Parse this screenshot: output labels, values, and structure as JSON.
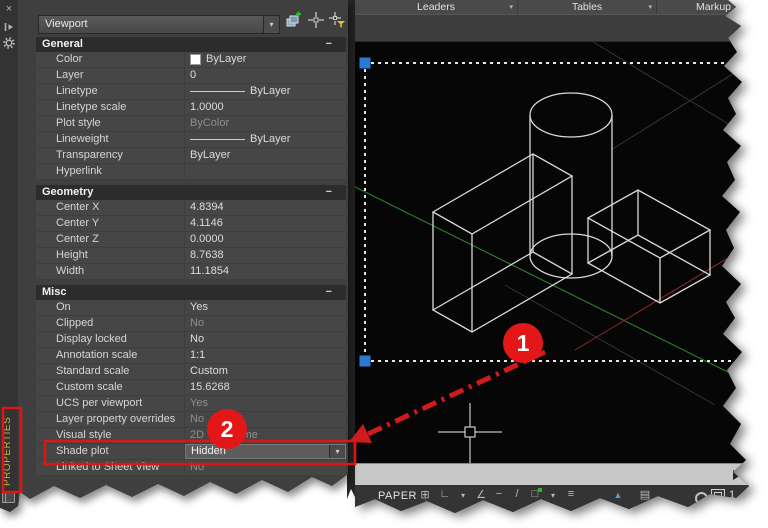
{
  "icons": {
    "dropdown_arrow": "▾",
    "collapse_minus": "−",
    "close": "×"
  },
  "ribbon": {
    "panels": [
      {
        "label": "Leaders"
      },
      {
        "label": "Tables"
      },
      {
        "label": "Markup"
      }
    ]
  },
  "palette": {
    "selector_value": "Viewport",
    "tab_label": "PROPERTIES",
    "sections": [
      {
        "title": "General",
        "rows": [
          {
            "label": "Color",
            "value": "ByLayer"
          },
          {
            "label": "Layer",
            "value": "0"
          },
          {
            "label": "Linetype",
            "value": "ByLayer"
          },
          {
            "label": "Linetype scale",
            "value": "1.0000"
          },
          {
            "label": "Plot style",
            "value": "ByColor"
          },
          {
            "label": "Lineweight",
            "value": "ByLayer"
          },
          {
            "label": "Transparency",
            "value": "ByLayer"
          },
          {
            "label": "Hyperlink",
            "value": ""
          }
        ]
      },
      {
        "title": "Geometry",
        "rows": [
          {
            "label": "Center X",
            "value": "4.8394"
          },
          {
            "label": "Center Y",
            "value": "4.1146"
          },
          {
            "label": "Center Z",
            "value": "0.0000"
          },
          {
            "label": "Height",
            "value": "8.7638"
          },
          {
            "label": "Width",
            "value": "11.1854"
          }
        ]
      },
      {
        "title": "Misc",
        "rows": [
          {
            "label": "On",
            "value": "Yes"
          },
          {
            "label": "Clipped",
            "value": "No"
          },
          {
            "label": "Display locked",
            "value": "No"
          },
          {
            "label": "Annotation scale",
            "value": "1:1"
          },
          {
            "label": "Standard scale",
            "value": "Custom"
          },
          {
            "label": "Custom scale",
            "value": "15.6268"
          },
          {
            "label": "UCS per viewport",
            "value": "Yes"
          },
          {
            "label": "Layer property overrides",
            "value": "No"
          },
          {
            "label": "Visual style",
            "value": "2D Wireframe"
          },
          {
            "label": "Shade plot",
            "value": "Hidden"
          },
          {
            "label": "Linked to Sheet View",
            "value": "No"
          }
        ]
      }
    ]
  },
  "statusbar": {
    "paper_label": "PAPER",
    "viewport_number": "1",
    "icons": [
      {
        "name": "snap",
        "glyph": "⊞"
      },
      {
        "name": "ortho",
        "glyph": "∟"
      },
      {
        "name": "ortho-flyout",
        "glyph": "▾"
      },
      {
        "name": "polar-tracking",
        "glyph": "∠"
      },
      {
        "name": "isodraft",
        "glyph": "−"
      },
      {
        "name": "osnap-diagonal",
        "glyph": "/"
      },
      {
        "name": "object-snap",
        "glyph": "□"
      },
      {
        "name": "osnap-flyout",
        "glyph": "▾"
      },
      {
        "name": "lineweight",
        "glyph": "≡"
      },
      {
        "name": "object-track",
        "glyph": "▲"
      },
      {
        "name": "annotation-monitor",
        "glyph": "▤"
      }
    ]
  },
  "annotations": {
    "callout_1": "1",
    "callout_2": "2"
  },
  "colors": {
    "annotation_red": "#e11414",
    "grip_blue": "#2a7ad4",
    "axis_green": "#2e8b2e",
    "axis_red": "#8b2a2a",
    "wireframe": "#d9d9d9"
  }
}
